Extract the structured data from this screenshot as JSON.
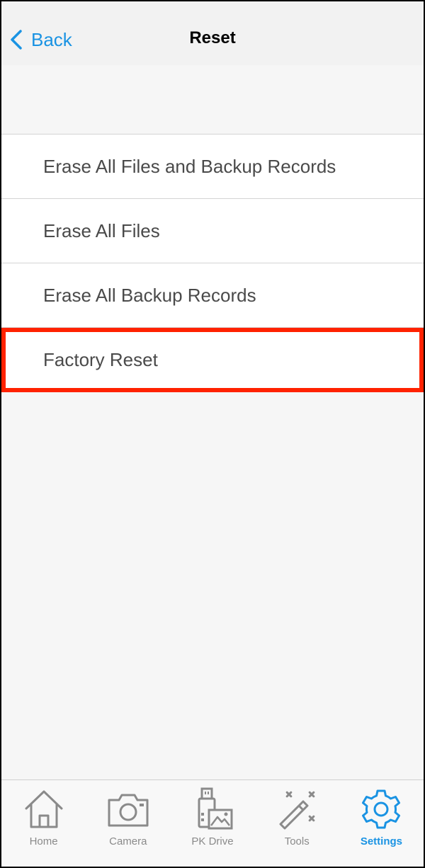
{
  "nav": {
    "back_label": "Back",
    "title": "Reset"
  },
  "menu": {
    "items": [
      {
        "label": "Erase All Files and Backup Records"
      },
      {
        "label": "Erase All Files"
      },
      {
        "label": "Erase All Backup Records"
      },
      {
        "label": "Factory Reset",
        "highlighted": true
      }
    ]
  },
  "tabs": [
    {
      "label": "Home",
      "icon": "home-icon"
    },
    {
      "label": "Camera",
      "icon": "camera-icon"
    },
    {
      "label": "PK Drive",
      "icon": "usb-drive-icon"
    },
    {
      "label": "Tools",
      "icon": "magic-wand-icon"
    },
    {
      "label": "Settings",
      "icon": "gear-icon",
      "active": true
    }
  ],
  "colors": {
    "accent": "#1a93e3",
    "highlight_border": "#ff2200",
    "inactive_tab": "#8a8a8a"
  }
}
